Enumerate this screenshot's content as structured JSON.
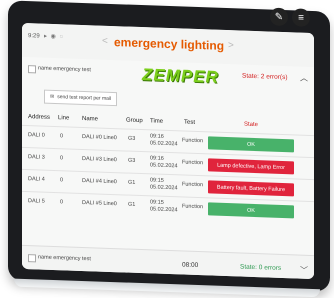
{
  "status_bar": {
    "time": "9:29",
    "icons": "▸ ◉ ◌"
  },
  "app": {
    "title": "emergency lighting",
    "nav_prev": "<",
    "nav_next": ">"
  },
  "group1": {
    "name": "name emergency test",
    "brand": "ZEMPER",
    "state": "State: 2 error(s)"
  },
  "report_button": {
    "label": "send test report per mail"
  },
  "table": {
    "headers": {
      "address": "Address",
      "line": "Line",
      "name": "Name",
      "group": "Group",
      "time": "Time",
      "test": "Test",
      "state": "State"
    },
    "rows": [
      {
        "address": "DALI 0",
        "line": "0",
        "name": "DALI #0 Line0",
        "group": "G3",
        "time": "09:16\n05.02.2024",
        "test": "Function",
        "state": "OK",
        "state_type": "ok"
      },
      {
        "address": "DALI 3",
        "line": "0",
        "name": "DALI #3 Line0",
        "group": "G3",
        "time": "09:16\n05.02.2024",
        "test": "Function",
        "state": "Lamp defective, Lamp Error",
        "state_type": "err"
      },
      {
        "address": "DALI 4",
        "line": "0",
        "name": "DALI #4 Line0",
        "group": "G1",
        "time": "09:15\n05.02.2024",
        "test": "Function",
        "state": "Battery fault, Battery Failure",
        "state_type": "err"
      },
      {
        "address": "DALI 5",
        "line": "0",
        "name": "DALI #5 Line0",
        "group": "G1",
        "time": "09:15\n05.02.2024",
        "test": "Function",
        "state": "OK",
        "state_type": "ok"
      }
    ]
  },
  "group2": {
    "name": "name emergency test",
    "time": "08:00",
    "state": "State: 0 errors"
  },
  "icons": {
    "edit": "pencil-icon",
    "menu": "menu-icon",
    "collapse": "chevron-up-icon",
    "expand": "chevron-down-icon"
  },
  "colors": {
    "accent": "#e55a00",
    "ok": "#48b26a",
    "error": "#e0243c",
    "brand": "#7ccf1c"
  }
}
